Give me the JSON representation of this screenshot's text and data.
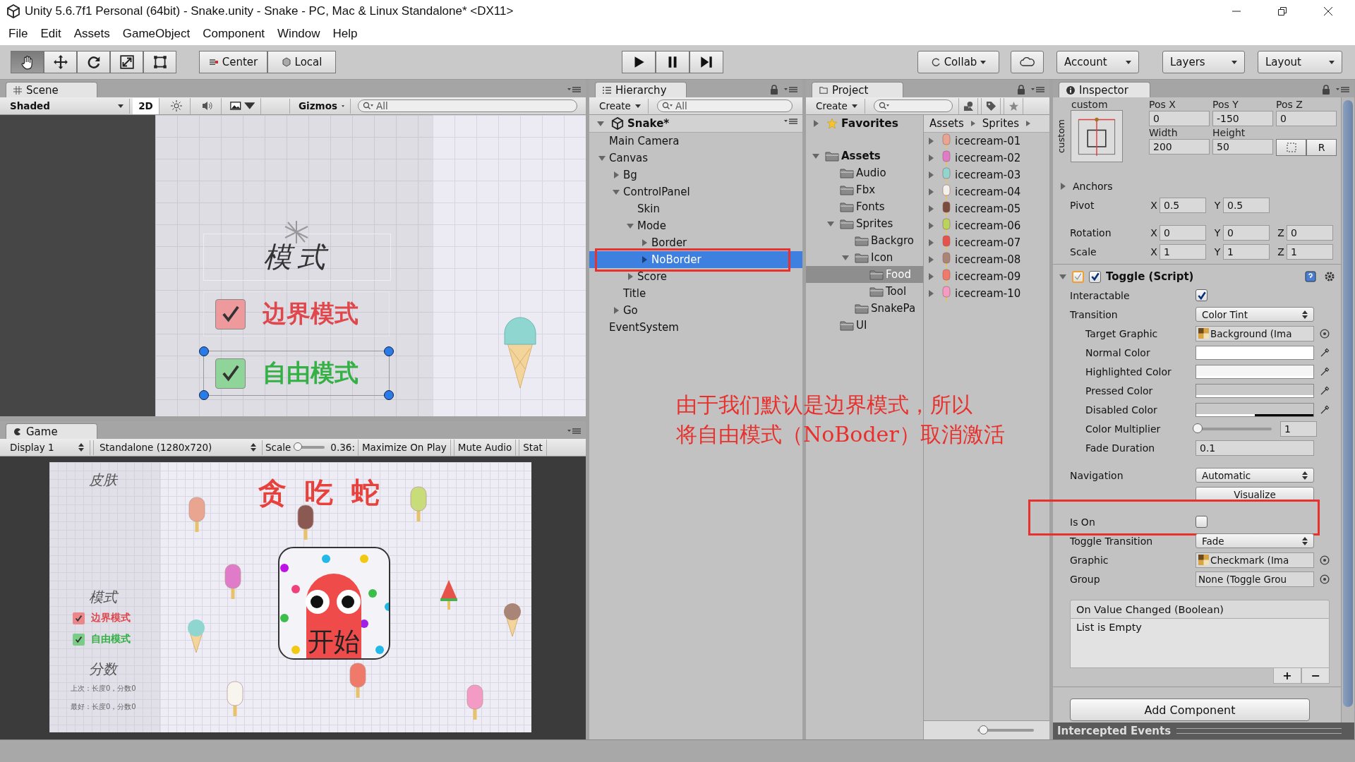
{
  "window": {
    "title": "Unity 5.6.7f1 Personal (64bit) - Snake.unity - Snake - PC, Mac & Linux Standalone* <DX11>"
  },
  "menu": [
    "File",
    "Edit",
    "Assets",
    "GameObject",
    "Component",
    "Window",
    "Help"
  ],
  "toolbar": {
    "tools": [
      {
        "selected": true
      },
      {
        "selected": false
      },
      {
        "selected": false
      },
      {
        "selected": false
      },
      {
        "selected": false
      }
    ],
    "pivot": "Center",
    "space": "Local",
    "collab": "Collab",
    "account": "Account",
    "layers": "Layers",
    "layout": "Layout"
  },
  "scene": {
    "tab": "Scene",
    "shading": "Shaded",
    "mode_2d": "2D",
    "mode_2d_on": true,
    "gizmos": "Gizmos",
    "search_placeholder": "All",
    "title": "模式",
    "toggles": [
      {
        "label": "边界模式",
        "checked": true,
        "color": "#e0474c",
        "selected": false
      },
      {
        "label": "自由模式",
        "checked": true,
        "color": "#34b045",
        "selected": true
      }
    ]
  },
  "game": {
    "tab": "Game",
    "display": "Display 1",
    "resolution": "Standalone (1280x720)",
    "scale_label": "Scale",
    "scale_slider": {
      "level": 0.05
    },
    "scale_reading": "0.36:",
    "maximize": "Maximize On Play",
    "mute": "Mute Audio",
    "stats": "Stat",
    "screen": {
      "skin": "皮肤",
      "title": "贪 吃 蛇",
      "mode": "模式",
      "toggles": [
        {
          "label": "边界模式",
          "checked": true,
          "color": "#e0474c"
        },
        {
          "label": "自由模式",
          "checked": true,
          "color": "#34b045"
        }
      ],
      "score": "分数",
      "last": "上次：长度0，分数0",
      "best": "最好：长度0，分数0",
      "start": "开始"
    }
  },
  "hierarchy": {
    "tab": "Hierarchy",
    "create": "Create",
    "search_placeholder": "All",
    "scene": "Snake*",
    "scene_expanded": true,
    "tree": [
      {
        "label": "Main Camera",
        "selected": false,
        "highlighted": false
      },
      {
        "label": "Canvas",
        "selected": false,
        "highlighted": false,
        "expanded": true,
        "children": [
          {
            "label": "Bg",
            "selected": false,
            "highlighted": false,
            "expanded": false
          },
          {
            "label": "ControlPanel",
            "selected": false,
            "highlighted": false,
            "expanded": true,
            "children": [
              {
                "label": "Skin",
                "selected": false,
                "highlighted": false
              },
              {
                "label": "Mode",
                "selected": false,
                "highlighted": false,
                "expanded": true,
                "children": [
                  {
                    "label": "Border",
                    "selected": false,
                    "highlighted": false,
                    "expanded": false
                  },
                  {
                    "label": "NoBorder",
                    "selected": true,
                    "highlighted": true,
                    "expanded": false
                  }
                ]
              },
              {
                "label": "Score",
                "selected": false,
                "highlighted": false,
                "expanded": false
              }
            ]
          },
          {
            "label": "Title",
            "selected": false,
            "highlighted": false
          },
          {
            "label": "Go",
            "selected": false,
            "highlighted": false,
            "expanded": false
          }
        ]
      },
      {
        "label": "EventSystem",
        "selected": false,
        "highlighted": false
      }
    ]
  },
  "project": {
    "tab": "Project",
    "create": "Create",
    "favorites": "Favorites",
    "favorites_expanded": false,
    "folders": [
      {
        "label": "Assets",
        "selected": false,
        "expanded": true,
        "children": [
          {
            "label": "Audio",
            "selected": false
          },
          {
            "label": "Fbx",
            "selected": false
          },
          {
            "label": "Fonts",
            "selected": false
          },
          {
            "label": "Sprites",
            "selected": false,
            "expanded": true,
            "children": [
              {
                "label": "Backgro",
                "selected": false
              },
              {
                "label": "Icon",
                "selected": false,
                "expanded": true,
                "children": [
                  {
                    "label": "Food",
                    "selected": true
                  },
                  {
                    "label": "Tool",
                    "selected": false
                  }
                ]
              },
              {
                "label": "SnakePa",
                "selected": false
              }
            ]
          },
          {
            "label": "UI",
            "selected": false
          }
        ]
      }
    ],
    "breadcrumb": [
      "Assets",
      "Sprites"
    ],
    "files": [
      {
        "label": "icecream-01",
        "expanded": false
      },
      {
        "label": "icecream-02",
        "expanded": false
      },
      {
        "label": "icecream-03",
        "expanded": false
      },
      {
        "label": "icecream-04",
        "expanded": false
      },
      {
        "label": "icecream-05",
        "expanded": false
      },
      {
        "label": "icecream-06",
        "expanded": false
      },
      {
        "label": "icecream-07",
        "expanded": false
      },
      {
        "label": "icecream-08",
        "expanded": false
      },
      {
        "label": "icecream-09",
        "expanded": false
      },
      {
        "label": "icecream-10",
        "expanded": false
      }
    ],
    "zoom_slider": {
      "level": 0.1
    }
  },
  "inspector": {
    "tab": "Inspector",
    "anchor_label": "custom",
    "anchor_side_label": "custom",
    "pos": [
      {
        "label": "Pos X",
        "value": "0"
      },
      {
        "label": "Pos Y",
        "value": "-150"
      },
      {
        "label": "Pos Z",
        "value": "0"
      }
    ],
    "size": [
      {
        "label": "Width",
        "value": "200"
      },
      {
        "label": "Height",
        "value": "50"
      }
    ],
    "raw_button": "R",
    "anchors": "Anchors",
    "anchors_expanded": false,
    "transform": [
      {
        "label": "Pivot",
        "fields": [
          {
            "axis": "X",
            "value": "0.5"
          },
          {
            "axis": "Y",
            "value": "0.5"
          }
        ]
      },
      {
        "label": "Rotation",
        "fields": [
          {
            "axis": "X",
            "value": "0"
          },
          {
            "axis": "Y",
            "value": "0"
          },
          {
            "axis": "Z",
            "value": "0"
          }
        ]
      },
      {
        "label": "Scale",
        "fields": [
          {
            "axis": "X",
            "value": "1"
          },
          {
            "axis": "Y",
            "value": "1"
          },
          {
            "axis": "Z",
            "value": "1"
          }
        ]
      }
    ],
    "component": {
      "title": "Toggle (Script)",
      "expanded": true,
      "gizmo_on": true,
      "enabled": true,
      "groups": [
        [
          {
            "kind": "checkbox",
            "label": "Interactable",
            "checked": true,
            "indented": false
          },
          {
            "kind": "dropdown",
            "label": "Transition",
            "value": "Color Tint",
            "indented": false
          },
          {
            "kind": "object",
            "label": "Target Graphic",
            "value": "Background (Ima",
            "asset_icon": true,
            "indented": true
          },
          {
            "kind": "color",
            "label": "Normal Color",
            "color": "#ffffff",
            "level": 1,
            "indented": true
          },
          {
            "kind": "color",
            "label": "Highlighted Color",
            "color": "#f5f5f5",
            "level": 1,
            "indented": true
          },
          {
            "kind": "color",
            "label": "Pressed Color",
            "color": "#c8c8c8",
            "level": 1,
            "indented": true
          },
          {
            "kind": "color",
            "label": "Disabled Color",
            "color": "#c8c8c8",
            "level": 0.5,
            "indented": true
          },
          {
            "kind": "slider",
            "label": "Color Multiplier",
            "level": 0,
            "value": "1",
            "indented": true
          },
          {
            "kind": "number",
            "label": "Fade Duration",
            "value": "0.1",
            "indented": true
          }
        ],
        [
          {
            "kind": "dropdown",
            "label": "Navigation",
            "value": "Automatic",
            "indented": false
          },
          {
            "kind": "button",
            "value": "Visualize",
            "indented": false
          }
        ],
        [
          {
            "kind": "checkbox",
            "label": "Is On",
            "checked": false,
            "indented": false,
            "highlighted": true
          },
          {
            "kind": "dropdown",
            "label": "Toggle Transition",
            "value": "Fade",
            "indented": false
          },
          {
            "kind": "object",
            "label": "Graphic",
            "value": "Checkmark (Ima",
            "asset_icon": true,
            "indented": false
          },
          {
            "kind": "object",
            "label": "Group",
            "value": "None (Toggle Grou",
            "asset_icon": false,
            "indented": false
          }
        ]
      ]
    },
    "event": {
      "title": "On Value Changed (Boolean)",
      "body": "List is Empty",
      "add": "+",
      "remove": "−"
    },
    "add_component": "Add Component",
    "intercepted": "Intercepted Events"
  },
  "annotation": {
    "lines": [
      "由于我们默认是边界模式，所以",
      "将自由模式（NoBoder）取消激活"
    ]
  }
}
